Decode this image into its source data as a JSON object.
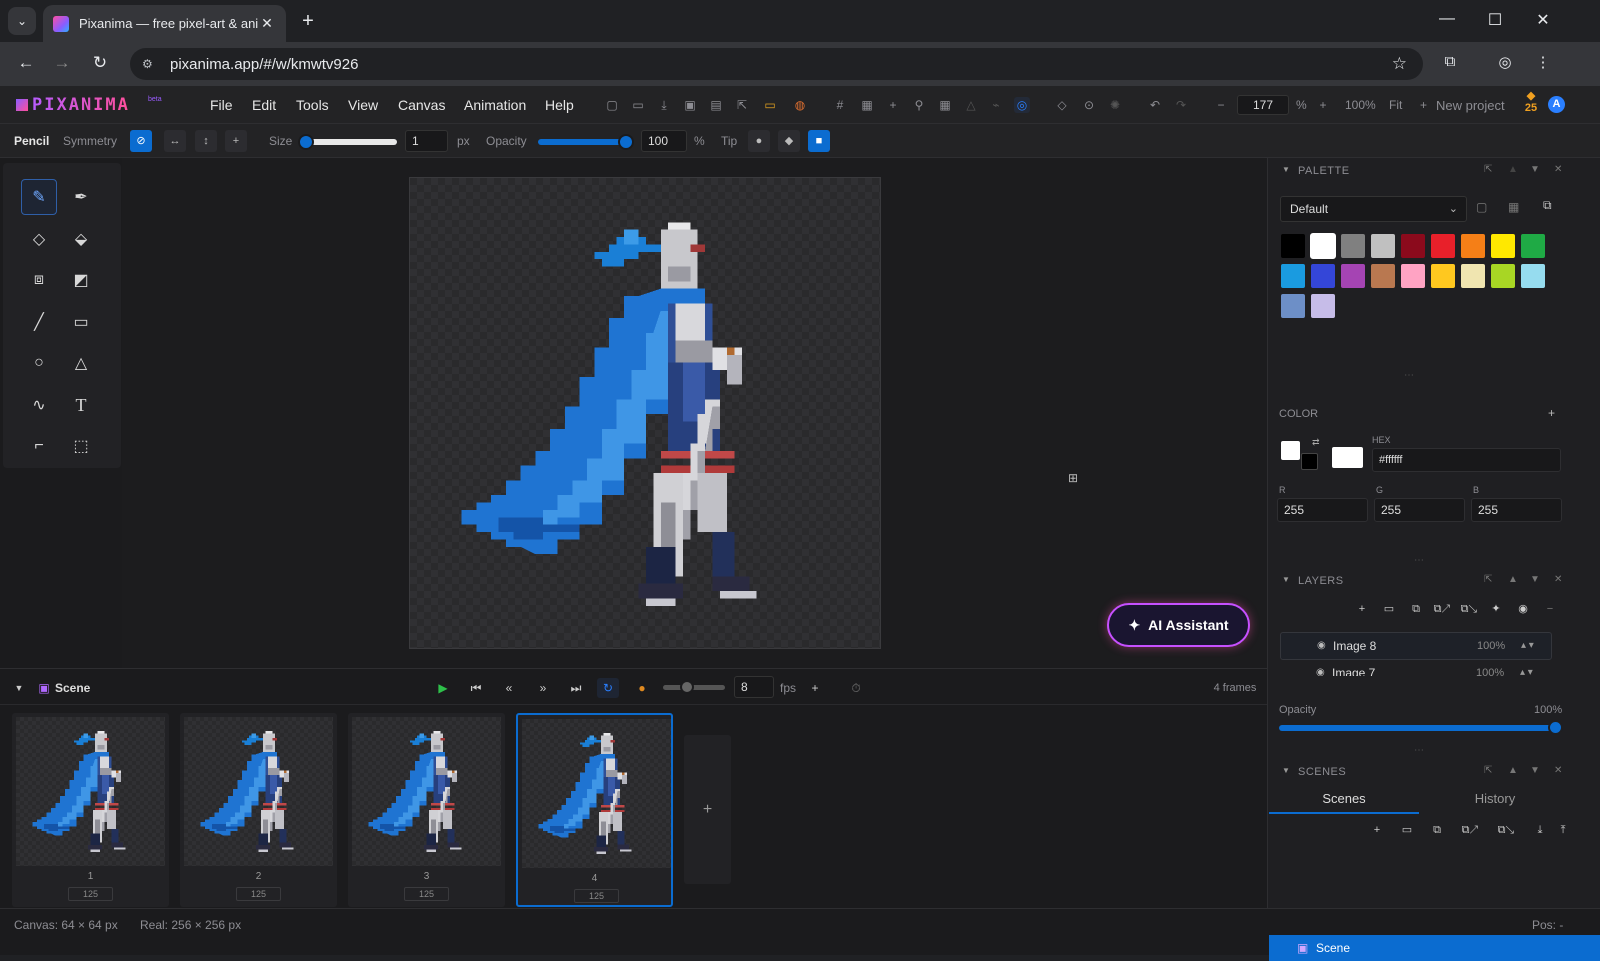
{
  "browser": {
    "tab_title": "Pixanima — free pixel-art & ani",
    "tab_close": "✕",
    "new_tab": "+",
    "url": "pixanima.app/#/w/kmwtv926",
    "back_icon": "←",
    "forward_icon": "→",
    "reload_icon": "↻",
    "minimize": "—",
    "maximize": "☐",
    "close": "✕"
  },
  "app": {
    "logo": "PIXANIMA",
    "logo_badge": "beta",
    "menu": [
      "File",
      "Edit",
      "Tools",
      "View",
      "Canvas",
      "Animation",
      "Help"
    ],
    "zoom_value": "177",
    "zoom_unit": "%",
    "zoom_100": "100%",
    "zoom_fit": "Fit",
    "new_project": "New project",
    "credits": "25",
    "avatar": "A",
    "accent_color": "#0b6cd0",
    "logo_gradient": [
      "#b65cff",
      "#ff4f9a"
    ]
  },
  "tool_options": {
    "tool_name": "Pencil",
    "symmetry_label": "Symmetry",
    "size_label": "Size",
    "size_value": "1",
    "size_unit": "px",
    "opacity_label": "Opacity",
    "opacity_value": "100",
    "opacity_unit": "%",
    "tip_label": "Tip"
  },
  "tools": [
    "pencil-icon",
    "pen-icon",
    "eraser-icon",
    "fill-bucket-icon",
    "shade-icon",
    "gradient-icon",
    "line-icon",
    "rectangle-icon",
    "ellipse-icon",
    "triangle-icon",
    "curve-icon",
    "text-icon",
    "eyedropper-icon",
    "selection-icon"
  ],
  "canvas": {
    "ai_button": "AI Assistant"
  },
  "timeline": {
    "scene_name": "Scene",
    "fps_value": "8",
    "fps_unit": "fps",
    "frame_count": "4 frames",
    "frames": [
      {
        "num": "1",
        "dur": "125"
      },
      {
        "num": "2",
        "dur": "125"
      },
      {
        "num": "3",
        "dur": "125"
      },
      {
        "num": "4",
        "dur": "125"
      }
    ],
    "selected_frame": 4,
    "add_frame": "+"
  },
  "status": {
    "canvas_size": "Canvas: 64 × 64 px",
    "real_size": "Real: 256 × 256 px",
    "pos": "Pos: -"
  },
  "palette": {
    "title": "PALETTE",
    "selected": "Default",
    "swatches": [
      "#000000",
      "#ffffff",
      "#808080",
      "#c0c0c0",
      "#8b0a1c",
      "#e8202a",
      "#f57f17",
      "#ffe800",
      "#1faa45",
      "#1a9be0",
      "#3446d8",
      "#a544b3",
      "#b97850",
      "#ffa3c3",
      "#ffc81f",
      "#f0e5b0",
      "#a8d624",
      "#96dcef",
      "#6d8fc7",
      "#c6bce8"
    ],
    "selected_swatch": 1
  },
  "color": {
    "title": "COLOR",
    "hex_label": "HEX",
    "hex_value": "#ffffff",
    "r_label": "R",
    "r": "255",
    "g_label": "G",
    "g": "255",
    "b_label": "B",
    "b": "255"
  },
  "layers": {
    "title": "LAYERS",
    "items": [
      {
        "name": "Image 8",
        "opacity": "100%"
      },
      {
        "name": "Image 7",
        "opacity": "100%"
      }
    ],
    "opacity_label": "Opacity",
    "opacity_value": "100%"
  },
  "scenes": {
    "title": "SCENES",
    "tab_scenes": "Scenes",
    "tab_history": "History",
    "items": [
      "Scene"
    ]
  }
}
